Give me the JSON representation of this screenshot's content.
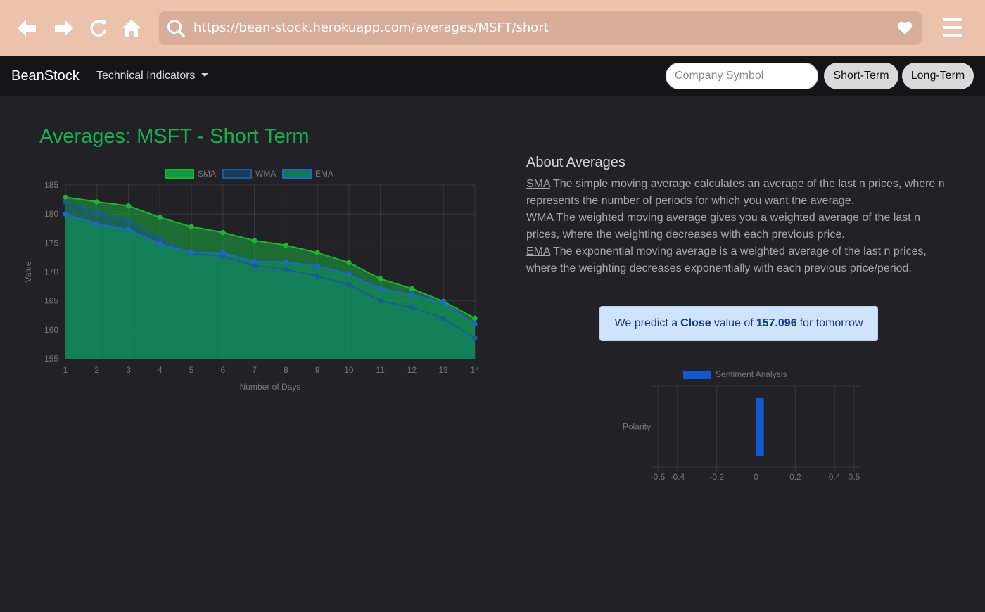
{
  "browser": {
    "url": "https://bean-stock.herokuapp.com/averages/MSFT/short",
    "icons": [
      "back-icon",
      "forward-icon",
      "reload-icon",
      "home-icon",
      "search-icon",
      "heart-icon",
      "menu-icon"
    ]
  },
  "navbar": {
    "brand": "BeanStock",
    "dropdown_label": "Technical Indicators",
    "symbol_placeholder": "Company Symbol",
    "short_term_label": "Short-Term",
    "long_term_label": "Long-Term"
  },
  "page": {
    "title": "Averages: MSFT - Short Term"
  },
  "about": {
    "title": "About Averages",
    "items": [
      {
        "abbr": "SMA",
        "text": " The simple moving average calculates an average of the last n prices, where n represents the number of periods for which you want the average."
      },
      {
        "abbr": "WMA",
        "text": " The weighted moving average gives you a weighted average of the last n prices, where the weighting decreases with each previous price."
      },
      {
        "abbr": "EMA",
        "text": " The exponential moving average is a weighted average of the last n prices, where the weighting decreases exponentially with each previous price/period."
      }
    ]
  },
  "prediction": {
    "prefix": "We predict a",
    "field": "Close",
    "middle": "value of",
    "value": "157.096",
    "suffix": "for tomorrow"
  },
  "colors": {
    "accent_green": "#1ab04f",
    "sma": "#19b832",
    "wma": "#1a5b9c",
    "ema": "#1e66d6",
    "sentiment": "#0d5bd1"
  },
  "chart_data": [
    {
      "type": "area",
      "title": "",
      "xlabel": "Number of Days",
      "ylabel": "Value",
      "categories": [
        "1",
        "2",
        "3",
        "4",
        "5",
        "6",
        "7",
        "8",
        "9",
        "10",
        "11",
        "12",
        "13",
        "14"
      ],
      "ylim": [
        155,
        185
      ],
      "yticks": [
        155,
        160,
        165,
        170,
        175,
        180,
        185
      ],
      "grid": true,
      "legend": "top",
      "series": [
        {
          "name": "SMA",
          "values": [
            182.9,
            182.1,
            181.4,
            179.4,
            177.8,
            176.8,
            175.4,
            174.6,
            173.3,
            171.6,
            168.8,
            167.1,
            164.9,
            162.0
          ]
        },
        {
          "name": "WMA",
          "values": [
            182.1,
            180.4,
            178.9,
            175.7,
            173.2,
            172.7,
            171.1,
            170.4,
            169.3,
            167.8,
            165.0,
            163.9,
            162.0,
            158.6
          ]
        },
        {
          "name": "EMA",
          "values": [
            180.0,
            178.3,
            177.3,
            174.8,
            173.4,
            173.3,
            171.8,
            171.7,
            171.0,
            169.6,
            167.1,
            166.1,
            164.7,
            161.0
          ]
        }
      ]
    },
    {
      "type": "bar",
      "orientation": "horizontal",
      "title": "",
      "categories": [
        "Polarity"
      ],
      "xticks": [
        "-0.5",
        "-0.4",
        "-0.2",
        "0",
        "0.2",
        "0.4",
        "0.5"
      ],
      "xlim": [
        -0.5,
        0.5
      ],
      "legend": "top",
      "series": [
        {
          "name": "Sentiment Analysis",
          "values": [
            0.04
          ]
        }
      ]
    }
  ]
}
